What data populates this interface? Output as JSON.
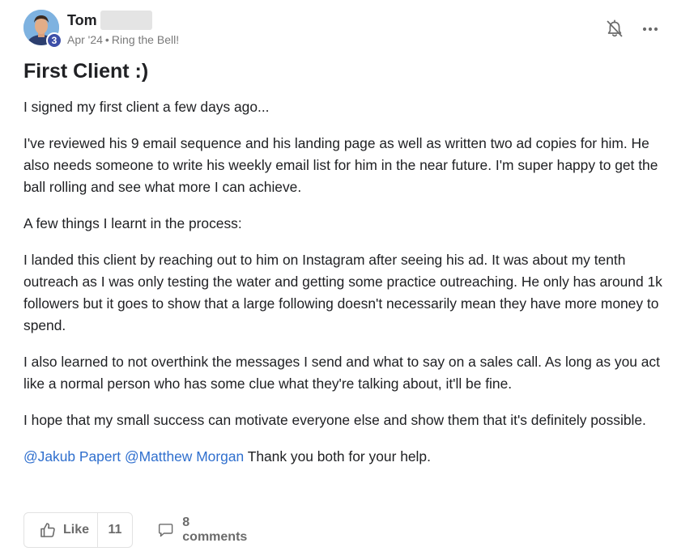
{
  "post": {
    "author": {
      "name": "Tom",
      "level": "3",
      "avatar_icon": "person-avatar"
    },
    "meta": {
      "date": "Apr '24",
      "separator": "•",
      "category": "Ring the Bell!"
    },
    "header_actions": {
      "bell_icon": "bell-off-icon",
      "more_icon": "more-horizontal-icon"
    },
    "title": "First Client :)",
    "paragraphs": [
      "I signed my first client a few days ago...",
      "I've reviewed his 9 email sequence and his landing page as well as written two ad copies for him. He also needs someone to write his weekly email list for him in the near future. I'm super happy to get the ball rolling and see what more I can achieve.",
      "A few things I learnt in the process:",
      "I landed this client by reaching out to him on Instagram after seeing his ad. It was about my tenth outreach as I was only testing the water and getting some practice outreaching. He only has around 1k followers but it goes to show that a large following doesn't necessarily mean they have more money to spend.",
      "I also learned to not overthink the messages I send and what to say on a sales call. As long as you act like a normal person who has some clue what they're talking about, it'll be fine.",
      "I hope that my small success can motivate everyone else and show them that it's definitely possible."
    ],
    "closing": {
      "mention_1": "@Jakub Papert",
      "mention_2": "@Matthew Morgan",
      "text": "Thank you both for your help."
    },
    "actions": {
      "like_label": "Like",
      "like_count": "11",
      "comments_label": "8 comments",
      "like_icon": "thumbs-up-icon",
      "comment_icon": "comment-icon"
    },
    "colors": {
      "mention": "#2f6fce",
      "badge": "#3d4fa8",
      "muted": "#6b6b6b"
    }
  }
}
